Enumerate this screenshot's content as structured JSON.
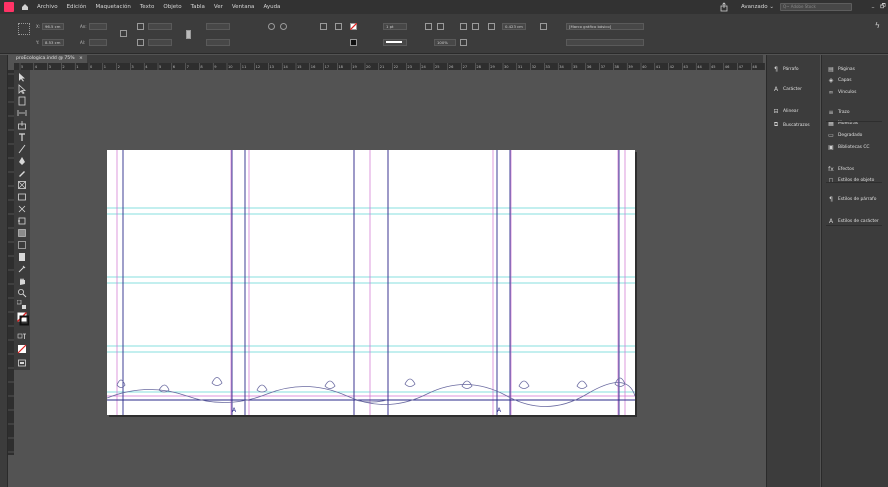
{
  "menu": {
    "items": [
      "Archivo",
      "Edición",
      "Maquetación",
      "Texto",
      "Objeto",
      "Tabla",
      "Ver",
      "Ventana",
      "Ayuda"
    ],
    "workspace": "Avanzado ⌄",
    "search_placeholder": "Q~ Adobe Stock",
    "minimize": "–",
    "restore": "🗗"
  },
  "controlbar": {
    "x_label": "X:",
    "x_value": "96.5 cm",
    "y_label": "Y:",
    "y_value": "8.53 cm",
    "w_label": "An:",
    "h_label": "Al:",
    "stroke_weight": "1 pt",
    "zoom": "100%",
    "measure": "0.423 cm",
    "frame_style": "[Marco gráfico básico]"
  },
  "document": {
    "tab_title": "proEcologica.indd @ 75%",
    "close": "×"
  },
  "ruler": {
    "h_ticks": [
      "5",
      "4",
      "3",
      "2",
      "1",
      "0",
      "1",
      "2",
      "3",
      "4",
      "5",
      "6",
      "7",
      "8",
      "9",
      "10",
      "11",
      "12",
      "13",
      "14",
      "15",
      "16",
      "17",
      "18",
      "19",
      "20",
      "21",
      "22",
      "23",
      "24",
      "25",
      "26",
      "27",
      "28",
      "29",
      "30",
      "31",
      "32",
      "33",
      "34",
      "35",
      "36",
      "37",
      "38",
      "39",
      "40",
      "41",
      "42",
      "43",
      "44",
      "45",
      "46",
      "47",
      "48",
      "49"
    ]
  },
  "panels": {
    "col1": [
      {
        "icon": "paragraph-icon",
        "glyph": "¶",
        "label": "Párrafo"
      },
      {
        "icon": "character-icon",
        "glyph": "A",
        "label": "Carácter"
      },
      {
        "icon": "align-icon",
        "glyph": "⊟",
        "label": "Alinear"
      },
      {
        "icon": "pathfinder-icon",
        "glyph": "⧉",
        "label": "Buscatrazos"
      }
    ],
    "col2": [
      {
        "icon": "pages-icon",
        "glyph": "▤",
        "label": "Páginas"
      },
      {
        "icon": "layers-icon",
        "glyph": "◈",
        "label": "Capas"
      },
      {
        "icon": "links-icon",
        "glyph": "∞",
        "label": "Vínculos"
      },
      {
        "icon": "stroke-icon",
        "glyph": "≡",
        "label": "Trazo"
      },
      {
        "icon": "swatches-icon",
        "glyph": "▦",
        "label": "Muestras"
      },
      {
        "icon": "gradient-icon",
        "glyph": "▭",
        "label": "Degradado"
      },
      {
        "icon": "cc-libraries-icon",
        "glyph": "▣",
        "label": "Bibliotecas CC"
      },
      {
        "icon": "effects-icon",
        "glyph": "fx",
        "label": "Efectos"
      },
      {
        "icon": "object-styles-icon",
        "glyph": "◻",
        "label": "Estilos de objeto"
      },
      {
        "icon": "paragraph-styles-icon",
        "glyph": "¶",
        "label": "Estilos de párrafo"
      },
      {
        "icon": "character-styles-icon",
        "glyph": "A",
        "label": "Estilos de carácter"
      }
    ]
  },
  "colors": {
    "guide_cyan": "#5fd4d4",
    "guide_magenta": "#d070d0",
    "column_blue": "#2a2a8a",
    "ornament": "#6a6aa0"
  }
}
